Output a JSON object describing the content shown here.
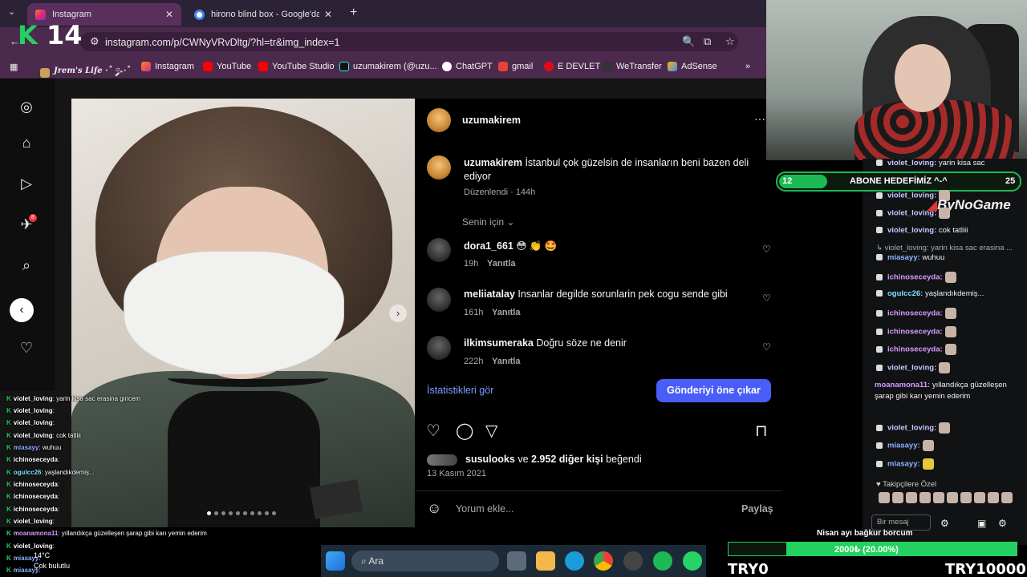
{
  "browser": {
    "tabs": [
      {
        "title": "Instagram",
        "active": true
      },
      {
        "title": "hirono blind box - Google'da A",
        "active": false
      }
    ],
    "url": "instagram.com/p/CWNyVRvDltg/?hl=tr&img_index=1",
    "bookmarks": [
      "Jrem's Life ·˚ ༘₊·˚",
      "Instagram",
      "YouTube",
      "YouTube Studio",
      "uzumakirem (@uzu...",
      "ChatGPT",
      "gmail",
      "E DEVLET",
      "WeTransfer",
      "AdSense"
    ],
    "more": "»"
  },
  "stream": {
    "k14": "14",
    "goal": {
      "current": "12",
      "label": "ABONE HEDEFİMİZ ^-^",
      "target": "25"
    },
    "brand": "ByNoGame",
    "nisan": "Nisan ayı bağkur borcum",
    "money": "2000₺ (20.00%)",
    "try_left": "TRY0",
    "try_right": "TRY10000",
    "weather": {
      "temp": "14°C",
      "label": "Çok bulutlu"
    },
    "taskbar_search": "Ara",
    "followers_only": "Takipçilere Özel",
    "chat_input": "Bir mesaj"
  },
  "post": {
    "username": "uzumakirem",
    "caption_user": "uzumakirem",
    "caption": "İstanbul çok güzelsin de insanların beni bazen deli ediyor",
    "edited": "Düzenlendi · 144h",
    "filter": "Senin için",
    "comments": [
      {
        "user": "dora1_661",
        "text": "😳 👏 🤩",
        "time": "19h",
        "reply": "Yanıtla"
      },
      {
        "user": "meliiatalay",
        "text": "Insanlar degilde sorunlarin pek cogu sende gibi",
        "time": "161h",
        "reply": "Yanıtla"
      },
      {
        "user": "ilkimsumeraka",
        "text": "Doğru söze ne denir",
        "time": "222h",
        "reply": "Yanıtla"
      }
    ],
    "stats_link": "İstatistikleri gör",
    "promote": "Gönderiyi öne çıkar",
    "likes_user": "susulooks",
    "likes_rest": "ve",
    "likes_count": "2.952 diğer kişi",
    "likes_suffix": "beğendi",
    "date": "13 Kasım 2021",
    "comment_placeholder": "Yorum ekle...",
    "share": "Paylaş"
  },
  "chat_right": [
    {
      "user": "violet_loving:",
      "text": "yarin kisa sac"
    },
    {
      "user": "violet_loving:",
      "text": ""
    },
    {
      "user": "violet_loving:",
      "text": ""
    },
    {
      "user": "violet_loving:",
      "text": "cok tatliii"
    },
    {
      "user": "violet_loving:",
      "text": "yarin kisa sac erasina ..."
    },
    {
      "user": "miasayy:",
      "text": "wuhuu"
    },
    {
      "user": "ichinoseceyda:",
      "text": ""
    },
    {
      "user": "ogulcc26:",
      "text": "yaşlandıkdemiş..."
    },
    {
      "user": "ichinoseceyda:",
      "text": ""
    },
    {
      "user": "ichinoseceyda:",
      "text": ""
    },
    {
      "user": "ichinoseceyda:",
      "text": ""
    },
    {
      "user": "violet_loving:",
      "text": ""
    }
  ],
  "chat_right_long": {
    "user": "moanamona11:",
    "text": "yıllandıkça güzelleşen şarap gibi karı yemin ederim"
  },
  "chat_right_tail": [
    {
      "user": "violet_loving:",
      "text": ""
    },
    {
      "user": "miasayy:",
      "text": ""
    },
    {
      "user": "miasayy:",
      "text": ""
    }
  ],
  "chat_left": [
    {
      "user": "violet_loving",
      "text": ": yarin kisa sac erasina giricem"
    },
    {
      "user": "violet_loving",
      "text": ":"
    },
    {
      "user": "violet_loving",
      "text": ":"
    },
    {
      "user": "violet_loving",
      "text": ": cok tatliii"
    },
    {
      "user": "miasayy",
      "text": ": wuhuu"
    },
    {
      "user": "ichinoseceyda",
      "text": ":"
    },
    {
      "user": "ogulcc26",
      "text": ": yaşlandıkdemiş..."
    },
    {
      "user": "ichinoseceyda",
      "text": ":"
    },
    {
      "user": "ichinoseceyda",
      "text": ":"
    },
    {
      "user": "ichinoseceyda",
      "text": ":"
    },
    {
      "user": "violet_loving",
      "text": ":"
    },
    {
      "user": "moanamona11",
      "text": ": yıllandıkça güzelleşen şarap gibi karı yemin ederim"
    },
    {
      "user": "violet_loving",
      "text": ":"
    },
    {
      "user": "miasayy",
      "text": ":"
    },
    {
      "user": "miasayy",
      "text": ":"
    }
  ],
  "colors": {
    "accent": "#4a5df9",
    "stream_green": "#23d160",
    "tab_active": "#5a2f5c"
  }
}
